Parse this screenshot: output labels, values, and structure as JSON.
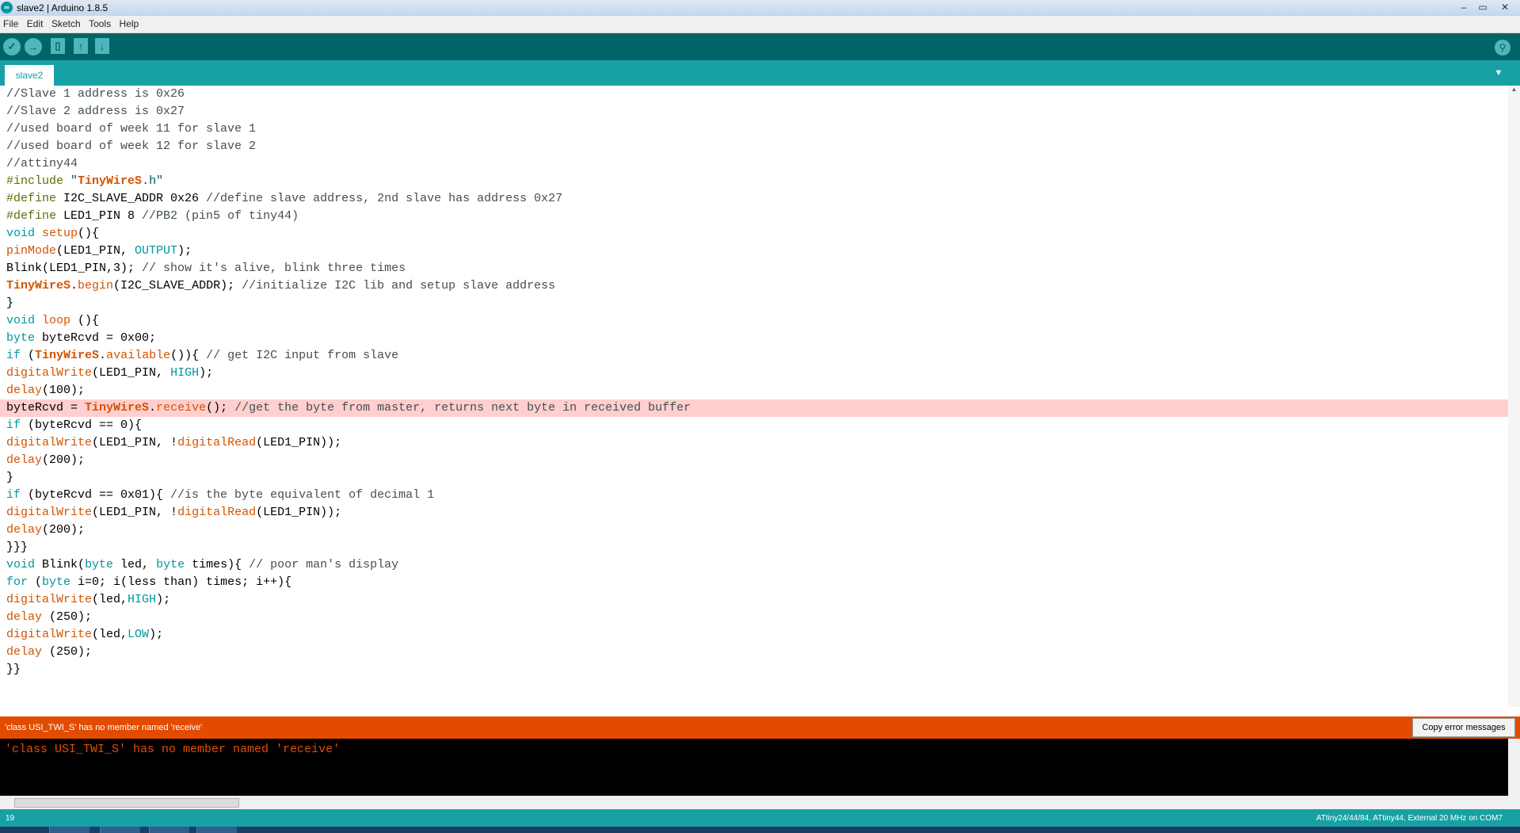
{
  "window": {
    "title": "slave2 | Arduino 1.8.5",
    "icon": "arduino-logo-icon",
    "minimize": "minimize-icon",
    "maximize": "maximize-icon",
    "close": "close-icon"
  },
  "menu": [
    "File",
    "Edit",
    "Sketch",
    "Tools",
    "Help"
  ],
  "toolbar": {
    "buttons": [
      "verify-icon",
      "upload-icon",
      "new-icon",
      "open-icon",
      "save-icon"
    ],
    "serial_monitor": "serial-monitor-icon"
  },
  "tabs": {
    "active": "slave2"
  },
  "code_lines": [
    "//Slave 1 address is 0x26",
    "//Slave 2 address is 0x27",
    "//used board of week 11 for slave 1",
    "//used board of week 12 for slave 2",
    "//attiny44",
    "#include \"TinyWireS.h\"",
    "#define I2C_SLAVE_ADDR 0x26 //define slave address, 2nd slave has address 0x27",
    "#define LED1_PIN 8 //PB2 (pin5 of tiny44)",
    "void setup(){",
    "pinMode(LED1_PIN, OUTPUT);",
    "Blink(LED1_PIN,3); // show it's alive, blink three times",
    "TinyWireS.begin(I2C_SLAVE_ADDR); //initialize I2C lib and setup slave address",
    "}",
    "void loop (){",
    "byte byteRcvd = 0x00;",
    "if (TinyWireS.available()){ // get I2C input from slave",
    "digitalWrite(LED1_PIN, HIGH);",
    "delay(100);",
    "byteRcvd = TinyWireS.receive(); //get the byte from master, returns next byte in received buffer",
    "if (byteRcvd == 0){",
    "digitalWrite(LED1_PIN, !digitalRead(LED1_PIN));",
    "delay(200);",
    "}",
    "if (byteRcvd == 0x01){ //is the byte equivalent of decimal 1",
    "digitalWrite(LED1_PIN, !digitalRead(LED1_PIN));",
    "delay(200);",
    "}}}",
    "void Blink(byte led, byte times){ // poor man's display",
    "for (byte i=0; i(less than) times; i++){",
    "digitalWrite(led,HIGH);",
    "delay (250);",
    "digitalWrite(led,LOW);",
    "delay (250);",
    "}}"
  ],
  "highlighted_line": 19,
  "error_bar": {
    "message": "'class USI_TWI_S' has no member named 'receive'",
    "copy_button": "Copy error messages"
  },
  "console": {
    "output": "'class USI_TWI_S' has no member named 'receive'"
  },
  "status": {
    "line_number": "19",
    "board": "ATtiny24/44/84, ATtiny44, External 20 MHz on COM7"
  },
  "colors": {
    "toolbar": "#006468",
    "tabbar": "#17a1a5",
    "error": "#e34c00",
    "highlight": "#ffcfcf",
    "console_bg": "#000000"
  }
}
